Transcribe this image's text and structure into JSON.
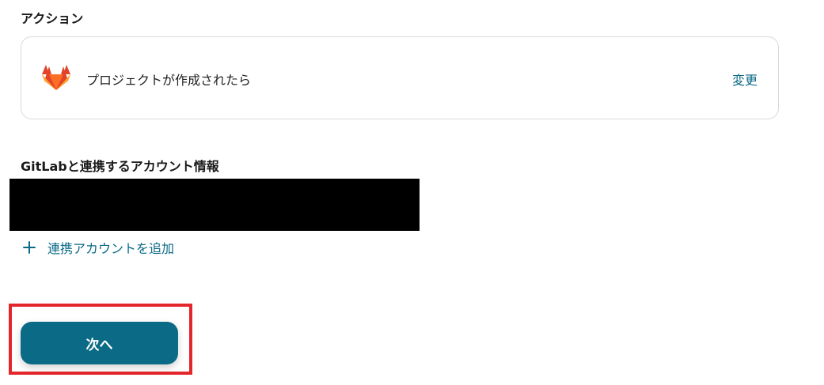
{
  "action_section": {
    "label": "アクション",
    "card": {
      "title": "プロジェクトが作成されたら",
      "change_label": "変更",
      "icon": "gitlab-logo"
    }
  },
  "account_section": {
    "label": "GitLabと連携するアカウント情報",
    "add_account_label": "連携アカウントを追加",
    "add_icon": "plus-icon"
  },
  "footer": {
    "next_label": "次へ"
  },
  "colors": {
    "accent": "#0b6a86",
    "highlight": "#e3262b",
    "card_border": "#d6d8db"
  }
}
